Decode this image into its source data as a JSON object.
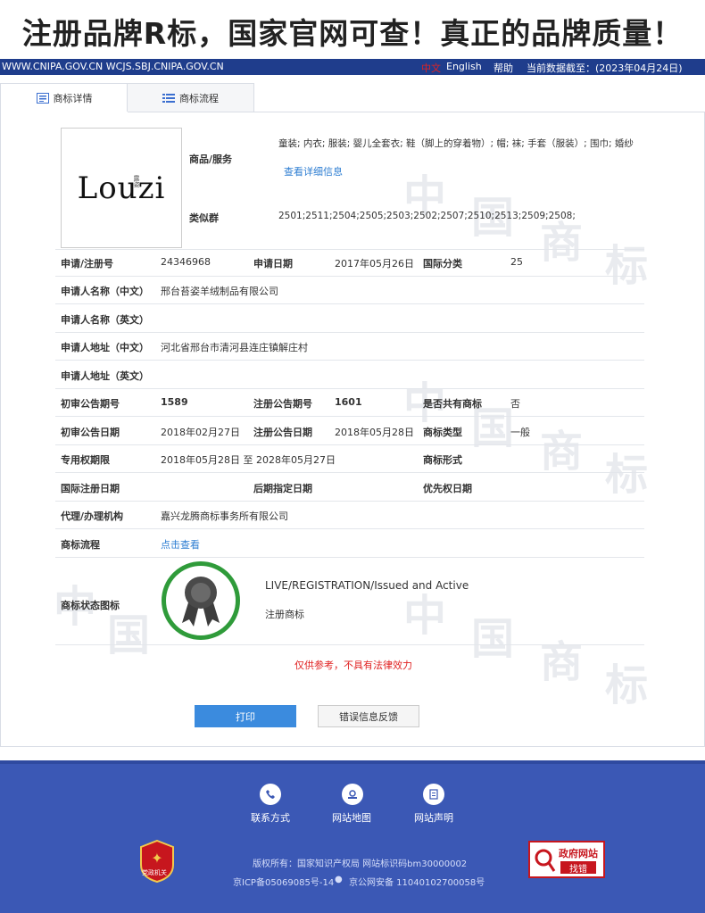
{
  "banner": {
    "text": "注册品牌R标，国家官网可查！真正的品牌质量！"
  },
  "topbar": {
    "urls": "WWW.CNIPA.GOV.CN WCJS.SBJ.CNIPA.GOV.CN",
    "lang_cn": "中文",
    "lang_en": "English",
    "help": "帮助",
    "date": "当前数据截至：(2023年04月24日)"
  },
  "tabs": [
    {
      "label": "商标详情",
      "icon": "details-icon"
    },
    {
      "label": "商标流程",
      "icon": "list-icon"
    }
  ],
  "logo": {
    "text": "Louzi",
    "small": "露姿"
  },
  "goods": {
    "label": "商品/服务",
    "value": "童装; 内衣; 服装; 婴儿全套衣; 鞋（脚上的穿着物）; 帽; 袜; 手套（服装）; 围巾; 婚纱",
    "detail_link": "查看详细信息"
  },
  "similar": {
    "label": "类似群",
    "value": "2501;2511;2504;2505;2503;2502;2507;2510;2513;2509;2508;"
  },
  "rows": {
    "reg_no_label": "申请/注册号",
    "reg_no": "24346968",
    "apply_date_label": "申请日期",
    "apply_date": "2017年05月26日",
    "class_label": "国际分类",
    "class_value": "25",
    "applicant_cn_label": "申请人名称（中文）",
    "applicant_cn": "邢台苔姿羊绒制品有限公司",
    "applicant_en_label": "申请人名称（英文）",
    "address_cn_label": "申请人地址（中文）",
    "address_cn": "河北省邢台市清河县连庄镇解庄村",
    "address_en_label": "申请人地址（英文）",
    "prelim_no_label": "初审公告期号",
    "prelim_no": "1589",
    "reg_pub_no_label": "注册公告期号",
    "reg_pub_no": "1601",
    "shared_label": "是否共有商标",
    "shared": "否",
    "prelim_date_label": "初审公告日期",
    "prelim_date": "2018年02月27日",
    "reg_pub_date_label": "注册公告日期",
    "reg_pub_date": "2018年05月28日",
    "type_label": "商标类型",
    "type": "一般",
    "period_label": "专用权期限",
    "period": "2018年05月28日 至 2028年05月27日",
    "form_label": "商标形式",
    "intl_date_label": "国际注册日期",
    "later_date_label": "后期指定日期",
    "priority_label": "优先权日期",
    "agent_label": "代理/办理机构",
    "agent": "嘉兴龙腾商标事务所有限公司",
    "process_label": "商标流程",
    "process_link": "点击查看",
    "status_label": "商标状态图标"
  },
  "status": {
    "en": "LIVE/REGISTRATION/Issued and Active",
    "cn": "注册商标",
    "ring_color": "#2f9b3a"
  },
  "watermark": [
    "中",
    "国",
    "商",
    "标"
  ],
  "disclaimer": "仅供参考，不具有法律效力",
  "buttons": {
    "print": "打印",
    "report": "错误信息反馈"
  },
  "footer": {
    "links": [
      {
        "label": "联系方式",
        "icon": "phone-icon"
      },
      {
        "label": "网站地图",
        "icon": "map-icon"
      },
      {
        "label": "网站声明",
        "icon": "document-icon"
      }
    ],
    "copyright": "版权所有：国家知识产权局 网站标识码bm30000002",
    "icp": "京ICP备05069085号-14",
    "police": "京公网安备 11040102700058号",
    "gov_box_title": "政府网站",
    "gov_box_sub": "找错",
    "badge_text": "党政机关"
  }
}
